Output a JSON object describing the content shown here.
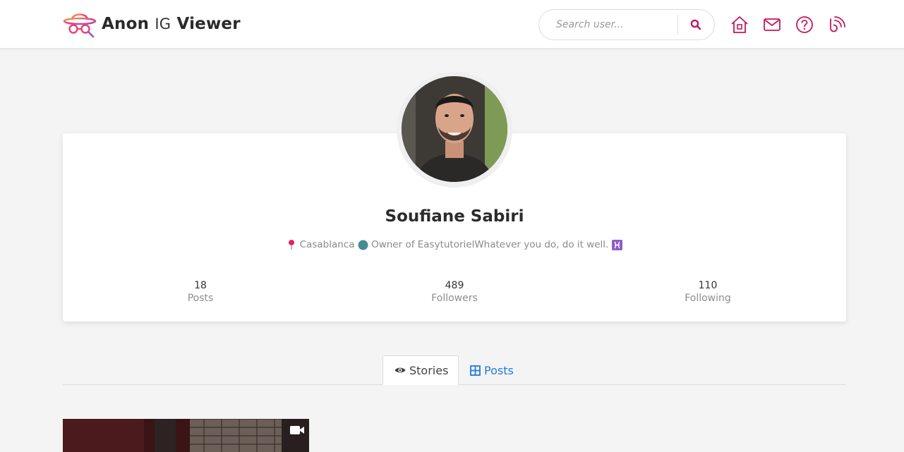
{
  "header": {
    "brand": {
      "part1": "Anon",
      "part2": "IG",
      "part3": "Viewer"
    },
    "search": {
      "placeholder": "Search user..."
    },
    "icons": [
      "search-icon",
      "home-icon",
      "mail-icon",
      "help-icon",
      "blog-icon"
    ],
    "accent": "#c2185b"
  },
  "profile": {
    "name": "Soufiane Sabiri",
    "bio": {
      "location": "Casablanca",
      "text": "Owner of EasytutorielWhatever you do, do it well."
    },
    "stats": [
      {
        "value": "18",
        "label": "Posts"
      },
      {
        "value": "489",
        "label": "Followers"
      },
      {
        "value": "110",
        "label": "Following"
      }
    ]
  },
  "tabs": [
    {
      "label": "Stories",
      "icon": "eye-icon",
      "active": true
    },
    {
      "label": "Posts",
      "icon": "grid-icon",
      "active": false
    }
  ],
  "stories": [
    {
      "type": "video",
      "icon": "video-camera-icon"
    }
  ]
}
